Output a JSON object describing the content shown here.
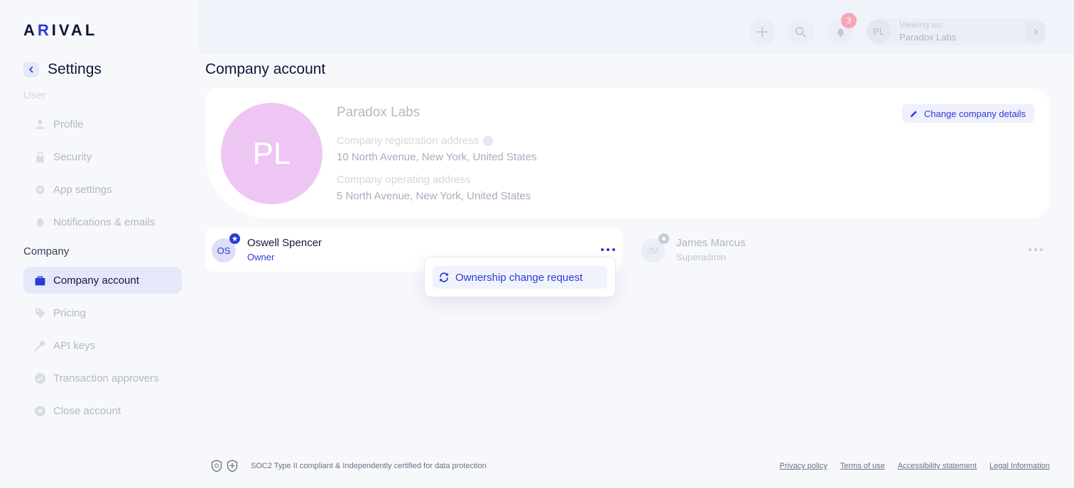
{
  "brand": {
    "logo_text_1": "A",
    "logo_accent": "R",
    "logo_text_2": "IVAL"
  },
  "sidebar": {
    "title": "Settings",
    "user_label": "User",
    "company_label": "Company",
    "user_items": [
      {
        "label": "Profile",
        "icon": "person-icon"
      },
      {
        "label": "Security",
        "icon": "lock-icon"
      },
      {
        "label": "App settings",
        "icon": "gear-icon"
      },
      {
        "label": "Notifications & emails",
        "icon": "bell-icon"
      }
    ],
    "company_items": [
      {
        "label": "Company account",
        "icon": "briefcase-icon",
        "active": true
      },
      {
        "label": "Pricing",
        "icon": "tag-icon"
      },
      {
        "label": "API keys",
        "icon": "key-icon"
      },
      {
        "label": "Transaction approvers",
        "icon": "check-badge-icon"
      },
      {
        "label": "Close account",
        "icon": "close-circle-icon"
      }
    ]
  },
  "topbar": {
    "notification_count": "3",
    "viewing_label": "Viewing as:",
    "viewing_value": "Paradox Labs",
    "viewing_initials": "PL"
  },
  "page": {
    "title": "Company account"
  },
  "company": {
    "initials": "PL",
    "name": "Paradox Labs",
    "reg_label": "Company registration address",
    "reg_value": "10 North Avenue, New York, United States",
    "op_label": "Company operating address",
    "op_value": "5 North Avenue, New York, United States",
    "change_label": "Change company details"
  },
  "members": [
    {
      "initials": "OS",
      "name": "Oswell Spencer",
      "role": "Owner"
    },
    {
      "initials": "JM",
      "name": "James Marcus",
      "role": "Superadmin"
    }
  ],
  "dropdown": {
    "item_label": "Ownership change request"
  },
  "footer": {
    "note": "SOC2 Type II compliant & Independently certified for data protection",
    "links": [
      "Privacy policy",
      "Terms of use",
      "Accessibility statement",
      "Legal Information"
    ]
  },
  "colors": {
    "accent": "#2b3bd6",
    "avatar_company": "#eec6f3",
    "badge": "#f4a7b5"
  }
}
